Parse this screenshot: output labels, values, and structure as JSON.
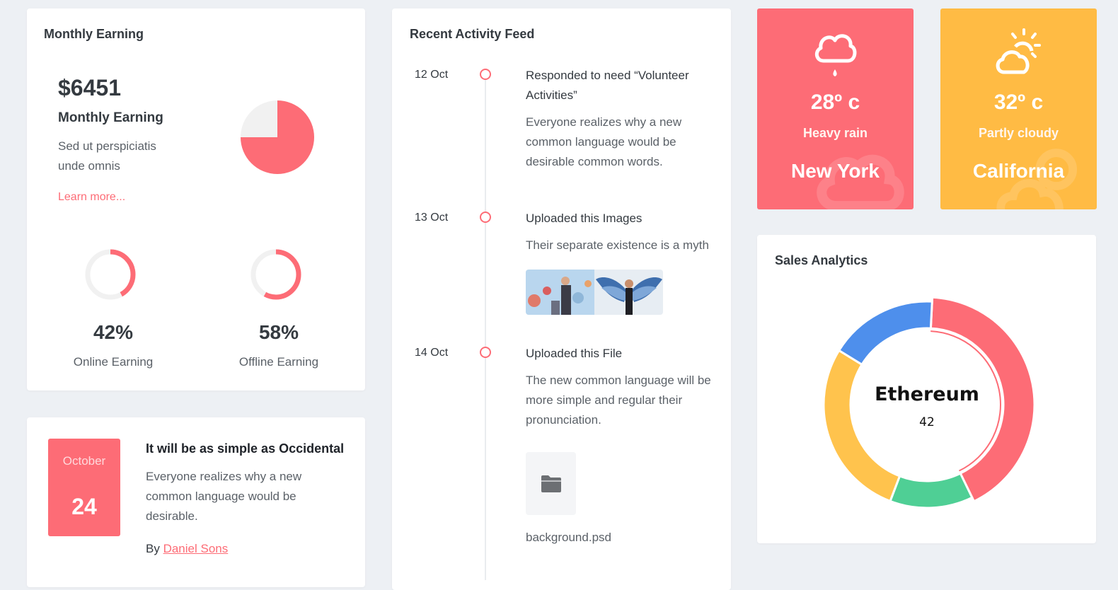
{
  "monthly_earning": {
    "title": "Monthly Earning",
    "amount": "$6451",
    "subtitle": "Monthly Earning",
    "description": "Sed ut perspiciatis unde omnis",
    "link_label": "Learn more...",
    "pie_fill_fraction": 0.75,
    "online": {
      "percent": 42,
      "label_pct": "42%",
      "label": "Online Earning"
    },
    "offline": {
      "percent": 58,
      "label_pct": "58%",
      "label": "Offline Earning"
    }
  },
  "event": {
    "month": "October",
    "day": "24",
    "title": "It will be as simple as Occidental",
    "description": "Everyone realizes why a new common language would be desirable.",
    "by_label": "By",
    "author": "Daniel Sons"
  },
  "activity_feed": {
    "title": "Recent Activity Feed",
    "items": [
      {
        "date": "12 Oct",
        "title": "Responded to need “Volunteer Activities”",
        "description": "Everyone realizes why a new common language would be desirable common words."
      },
      {
        "date": "13 Oct",
        "title": "Uploaded this Images",
        "description": "Their separate existence is a myth"
      },
      {
        "date": "14 Oct",
        "title": "Uploaded this File",
        "description": "The new common language will be more simple and regular their pronunciation.",
        "file_name": "background.psd"
      }
    ]
  },
  "weather": [
    {
      "temp": "28º c",
      "condition": "Heavy rain",
      "city": "New York",
      "icon": "rain-cloud-icon",
      "color": "#fd6c76"
    },
    {
      "temp": "32º c",
      "condition": "Partly cloudy",
      "city": "California",
      "icon": "partly-cloudy-icon",
      "color": "#ffbb44"
    }
  ],
  "sales_analytics": {
    "title": "Sales Analytics",
    "center_label": "Ethereum",
    "center_value": "42",
    "segments": [
      {
        "value": 42,
        "color": "#fd6c76"
      },
      {
        "value": 13,
        "color": "#4fcf95"
      },
      {
        "value": 28,
        "color": "#ffc34d"
      },
      {
        "value": 17,
        "color": "#4e8fec"
      }
    ]
  },
  "colors": {
    "accent": "#fd6c76",
    "warning": "#ffbb44",
    "success": "#4fcf95",
    "info": "#4e8fec",
    "track": "#f1f1f1"
  }
}
